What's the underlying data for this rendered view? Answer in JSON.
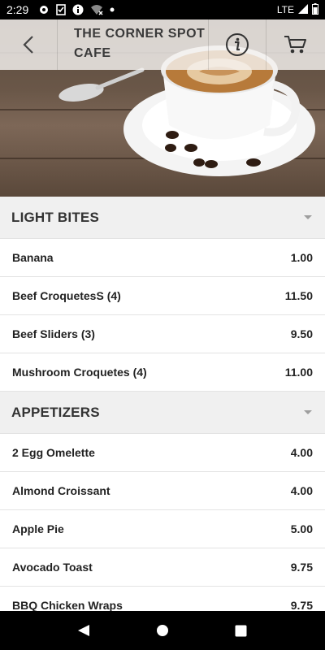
{
  "status_bar": {
    "time": "2:29",
    "network": "LTE"
  },
  "header": {
    "title_line1": "THE CORNER SPOT",
    "title_line2": "CAFE"
  },
  "sections": [
    {
      "title": "LIGHT BITES",
      "items": [
        {
          "name": "Banana",
          "price": "1.00"
        },
        {
          "name": "Beef CroquetesS (4)",
          "price": "11.50"
        },
        {
          "name": "Beef Sliders (3)",
          "price": "9.50"
        },
        {
          "name": "Mushroom Croquetes (4)",
          "price": "11.00"
        }
      ]
    },
    {
      "title": "APPETIZERS",
      "items": [
        {
          "name": "2 Egg Omelette",
          "price": "4.00"
        },
        {
          "name": "Almond Croissant",
          "price": "4.00"
        },
        {
          "name": "Apple Pie",
          "price": "5.00"
        },
        {
          "name": "Avocado Toast",
          "price": "9.75"
        },
        {
          "name": "BBQ Chicken Wraps",
          "price": "9.75"
        }
      ]
    }
  ]
}
